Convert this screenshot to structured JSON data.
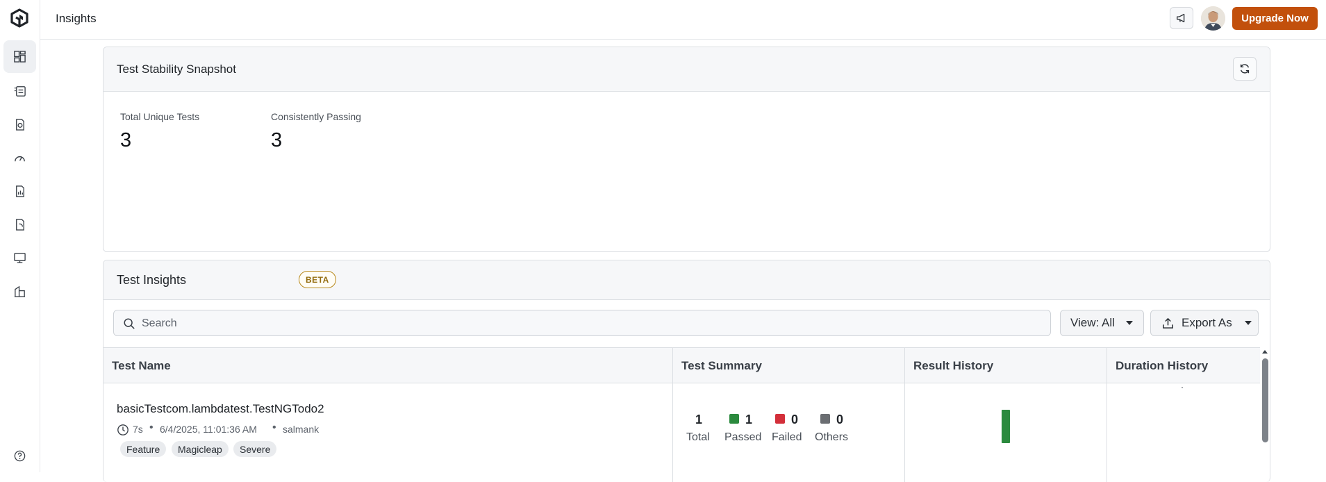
{
  "header": {
    "title": "Insights",
    "upgrade_label": "Upgrade Now"
  },
  "sidebar": {
    "items": [
      {
        "name": "dashboard-icon",
        "active": true
      },
      {
        "name": "test-list-icon",
        "active": false
      },
      {
        "name": "test-report-icon",
        "active": false
      },
      {
        "name": "speedometer-icon",
        "active": false
      },
      {
        "name": "analytics-report-icon",
        "active": false
      },
      {
        "name": "mobile-report-icon",
        "active": false
      },
      {
        "name": "monitor-icon",
        "active": false
      },
      {
        "name": "building-icon",
        "active": false
      }
    ],
    "help_icon": "help-icon"
  },
  "snapshot": {
    "title": "Test Stability Snapshot",
    "stats": [
      {
        "label": "Total Unique Tests",
        "value": "3"
      },
      {
        "label": "Consistently Passing",
        "value": "3"
      }
    ]
  },
  "insights": {
    "title": "Test Insights",
    "badge": "BETA",
    "search_placeholder": "Search",
    "view_label": "View: All",
    "export_label": "Export As",
    "columns": [
      "Test Name",
      "Test Summary",
      "Result History",
      "Duration History"
    ],
    "rows": [
      {
        "name": "basicTestcom.lambdatest.TestNGTodo2",
        "duration": "7s",
        "timestamp": "6/4/2025, 11:01:36 AM",
        "user": "salmank",
        "tags": [
          "Feature",
          "Magicleap",
          "Severe"
        ],
        "summary": {
          "total": "1",
          "total_label": "Total",
          "passed": "1",
          "passed_label": "Passed",
          "failed": "0",
          "failed_label": "Failed",
          "others": "0",
          "others_label": "Others"
        }
      }
    ]
  },
  "colors": {
    "accent": "#c2500c",
    "passed": "#2b8a3e",
    "failed": "#d32f3a",
    "others": "#6b6e72",
    "beta": "#b8891c"
  }
}
